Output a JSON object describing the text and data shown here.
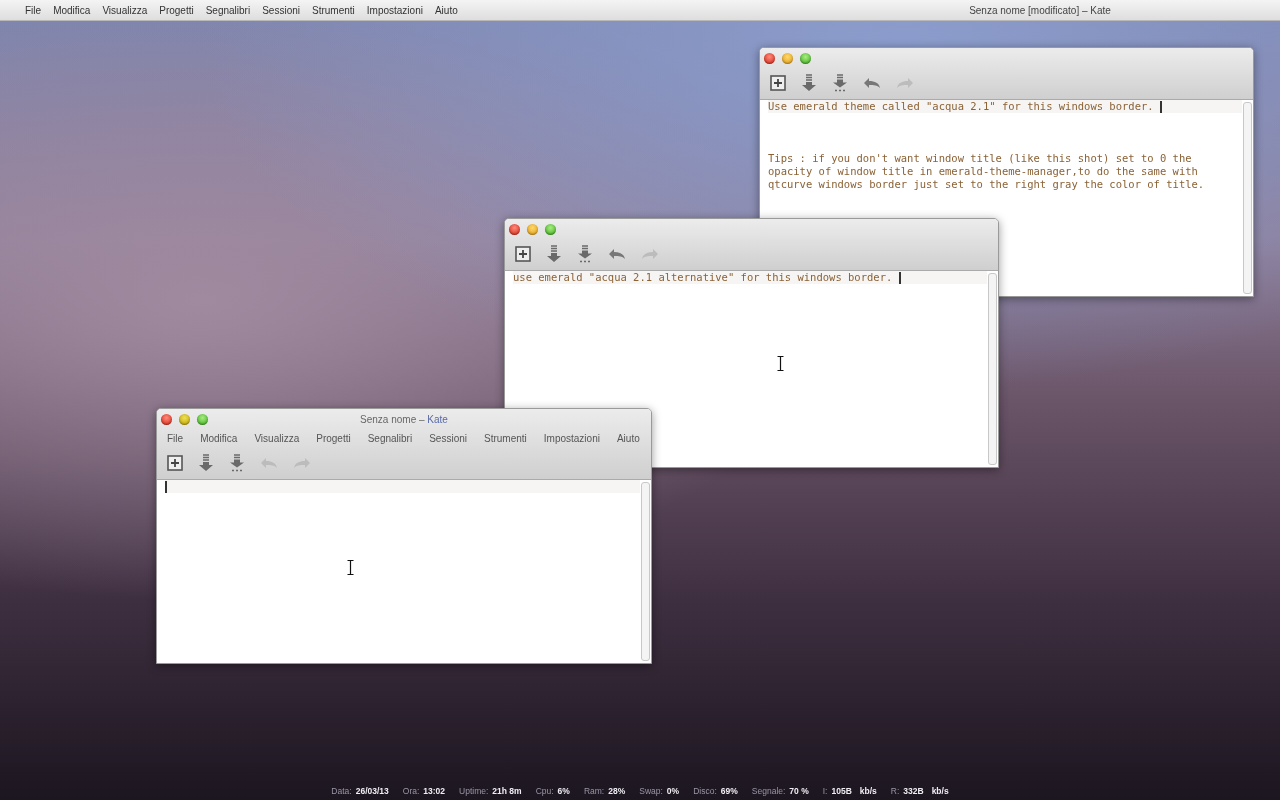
{
  "top_bar": {
    "menu": [
      "File",
      "Modifica",
      "Visualizza",
      "Progetti",
      "Segnalibri",
      "Sessioni",
      "Strumenti",
      "Impostazioni",
      "Aiuto"
    ],
    "title": "Senza nome [modificato] – Kate"
  },
  "windows": [
    {
      "toolbar": [
        {
          "kind": "new",
          "disabled": false
        },
        {
          "kind": "save",
          "disabled": false
        },
        {
          "kind": "save-as",
          "disabled": false
        },
        {
          "kind": "undo",
          "disabled": false
        },
        {
          "kind": "redo",
          "disabled": true
        }
      ],
      "current_line": "Use emerald theme called \"acqua 2.1\" for this windows border. ",
      "body_lines": [
        "Tips : if you don't want window title (like this shot) set to 0 the",
        "opacity of window title in emerald-theme-manager,to do the same with",
        "qtcurve windows border just set to the right gray the color of title."
      ],
      "mouse_pointer": false
    },
    {
      "toolbar": [
        {
          "kind": "new",
          "disabled": false
        },
        {
          "kind": "save",
          "disabled": false
        },
        {
          "kind": "save-as",
          "disabled": false
        },
        {
          "kind": "undo",
          "disabled": false
        },
        {
          "kind": "redo",
          "disabled": true
        }
      ],
      "current_line": "use emerald \"acqua 2.1 alternative\" for this windows border. ",
      "mouse_pointer": true
    },
    {
      "title": "Senza nome",
      "title_separator": "–",
      "title_app": "Kate",
      "menu": [
        "File",
        "Modifica",
        "Visualizza",
        "Progetti",
        "Segnalibri",
        "Sessioni",
        "Strumenti",
        "Impostazioni",
        "Aiuto"
      ],
      "toolbar": [
        {
          "kind": "new",
          "disabled": false
        },
        {
          "kind": "save",
          "disabled": false
        },
        {
          "kind": "save-as",
          "disabled": false
        },
        {
          "kind": "undo",
          "disabled": true
        },
        {
          "kind": "redo",
          "disabled": true
        }
      ],
      "mouse_pointer": true
    }
  ],
  "status_bar": [
    {
      "label": "Data:",
      "value": "26/03/13"
    },
    {
      "label": "Ora:",
      "value": "13:02"
    },
    {
      "label": "Uptime:",
      "value": "21h 8m"
    },
    {
      "label": "Cpu:",
      "value": "6%"
    },
    {
      "label": "Ram:",
      "value": "28%"
    },
    {
      "label": "Swap:",
      "value": "0%"
    },
    {
      "label": "Disco:",
      "value": "69%"
    },
    {
      "label": "Segnale:",
      "value": "70 %"
    },
    {
      "label": "I:",
      "value": "105B",
      "unit": "kb/s"
    },
    {
      "label": "R:",
      "value": "332B",
      "unit": "kb/s"
    }
  ]
}
